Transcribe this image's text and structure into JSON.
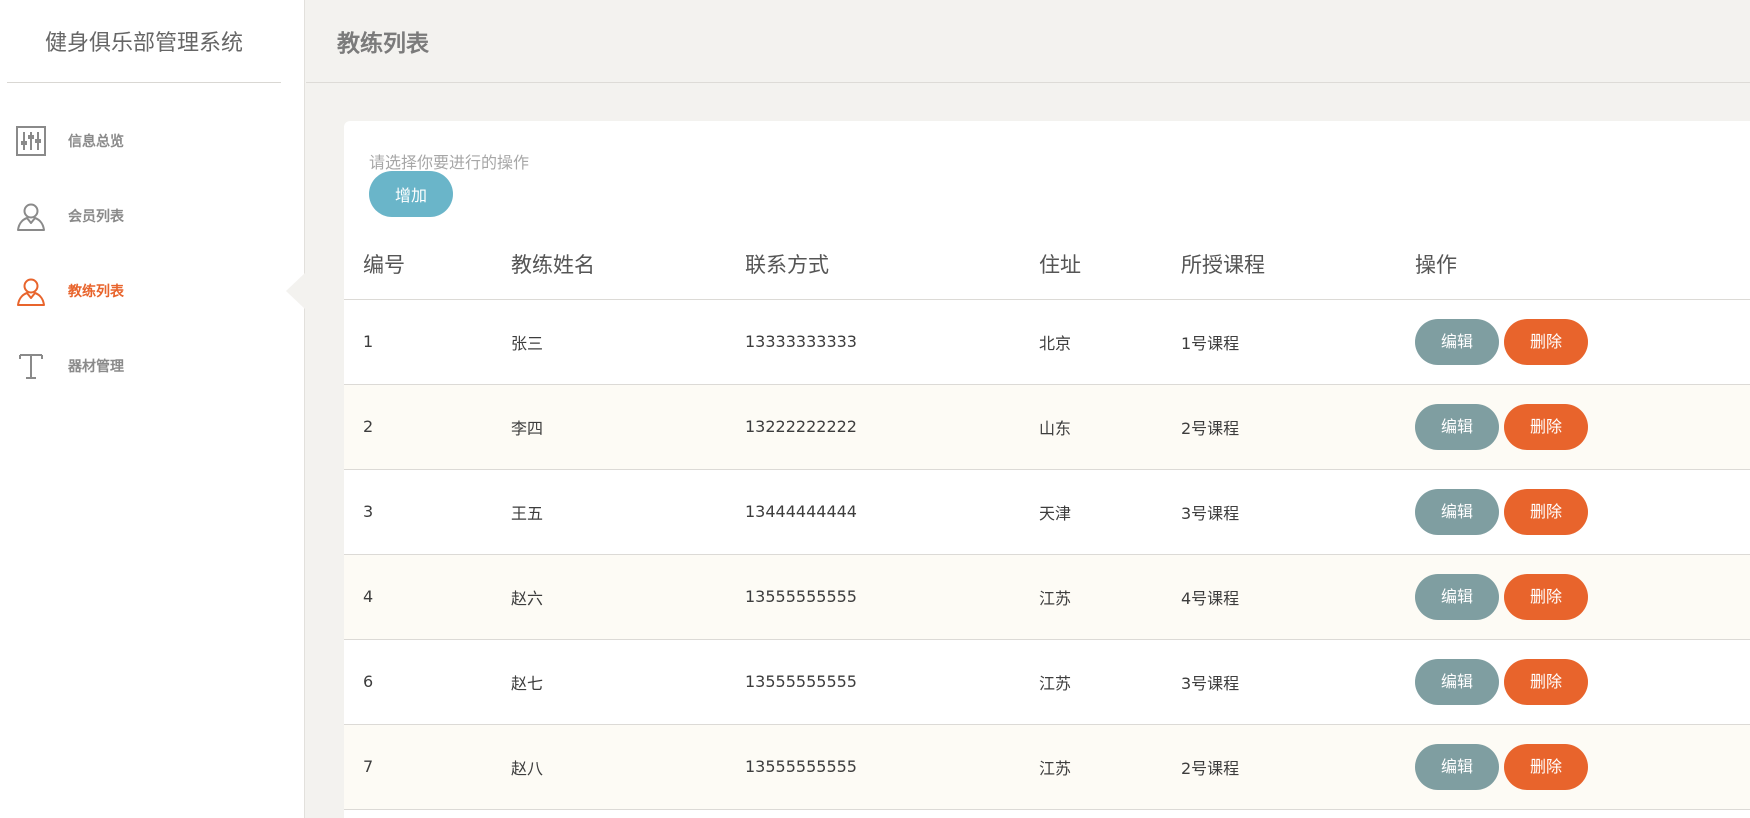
{
  "app": {
    "title": "健身俱乐部管理系统"
  },
  "colors": {
    "accent": "#e8642c",
    "add_button": "#6ab5c9",
    "edit_button": "#7f9ea1",
    "delete_button": "#e8642c"
  },
  "sidebar": {
    "items": [
      {
        "label": "信息总览",
        "icon": "sliders-icon",
        "active": false
      },
      {
        "label": "会员列表",
        "icon": "user-icon",
        "active": false
      },
      {
        "label": "教练列表",
        "icon": "user-icon",
        "active": true
      },
      {
        "label": "器材管理",
        "icon": "text-t-icon",
        "active": false
      }
    ]
  },
  "header": {
    "title": "教练列表"
  },
  "main": {
    "prompt": "请选择你要进行的操作",
    "add_label": "增加",
    "columns": [
      "编号",
      "教练姓名",
      "联系方式",
      "住址",
      "所授课程",
      "操作"
    ],
    "rows": [
      {
        "id": "1",
        "name": "张三",
        "phone": "13333333333",
        "address": "北京",
        "course": "1号课程"
      },
      {
        "id": "2",
        "name": "李四",
        "phone": "13222222222",
        "address": "山东",
        "course": "2号课程"
      },
      {
        "id": "3",
        "name": "王五",
        "phone": "13444444444",
        "address": "天津",
        "course": "3号课程"
      },
      {
        "id": "4",
        "name": "赵六",
        "phone": "13555555555",
        "address": "江苏",
        "course": "4号课程"
      },
      {
        "id": "6",
        "name": "赵七",
        "phone": "13555555555",
        "address": "江苏",
        "course": "3号课程"
      },
      {
        "id": "7",
        "name": "赵八",
        "phone": "13555555555",
        "address": "江苏",
        "course": "2号课程"
      }
    ],
    "edit_label": "编辑",
    "delete_label": "删除"
  }
}
